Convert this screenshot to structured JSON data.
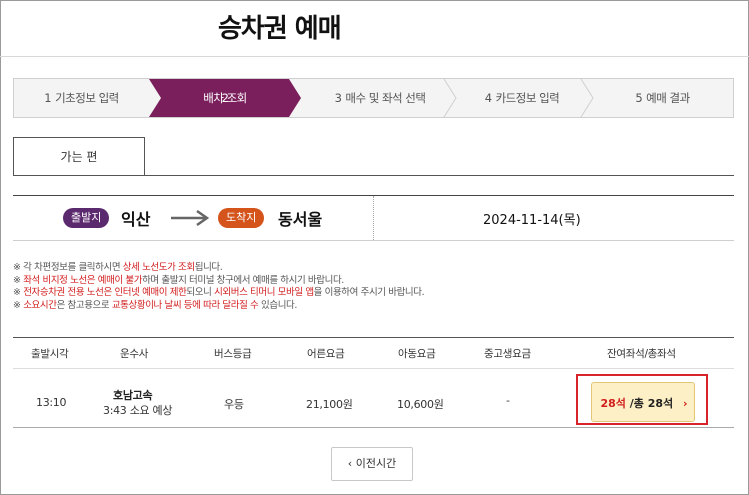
{
  "page_title": "승차권 예매",
  "steps": [
    {
      "num": "1",
      "label": "기초정보 입력"
    },
    {
      "num": "2",
      "label": "배차 조회"
    },
    {
      "num": "3",
      "label": "매수 및 좌석 선택"
    },
    {
      "num": "4",
      "label": "카드정보 입력"
    },
    {
      "num": "5",
      "label": "예매 결과"
    }
  ],
  "tab_label": "가는 편",
  "route": {
    "departure_badge": "출발지",
    "departure": "익산",
    "arrival_badge": "도착지",
    "arrival": "동서울",
    "date": "2024-11-14(목)"
  },
  "notices": {
    "n1": {
      "a": "※ 각 차편정보를 클릭하시면 ",
      "b": "상세 노선도가 조회",
      "c": "됩니다."
    },
    "n2": {
      "a": "※ ",
      "b": "좌석 비지정 노선은 예매이 불가",
      "c": "하며 출발지 터미널 창구에서 예매를 하시기 바랍니다."
    },
    "n3": {
      "a": "※ ",
      "b": "전자승차권 전용 노선은 인터넷 예매이 제한",
      "c": "되오니 ",
      "d": "시외버스 티머니 모바일 앱",
      "e": "을 이용하여 주시기 바랍니다."
    },
    "n4": {
      "a": "※ ",
      "b": "소요시간",
      "c": "은 참고용으로 ",
      "d": "교통상황이나 날씨 등에 따라 달라질 수",
      "e": " 있습니다."
    }
  },
  "table": {
    "headers": [
      "출발시각",
      "운수사",
      "버스등급",
      "어른요금",
      "아동요금",
      "중고생요금",
      "잔여좌석/총좌석"
    ],
    "row": {
      "time": "13:10",
      "company": "호남고속",
      "duration": "3:43 소요 예상",
      "grade": "우등",
      "adult_fare": "21,100원",
      "child_fare": "10,600원",
      "student_fare": "-",
      "seats_left": "28석",
      "seats_total": " /총 28석",
      "seat_arrow": "›"
    }
  },
  "prev_button": "이전시간",
  "prev_icon": "‹",
  "colors": {
    "active_step": "#7a1f5c",
    "departure_badge": "#5b2a6e",
    "arrival_badge": "#d4541c",
    "highlight": "#d21d1d"
  }
}
